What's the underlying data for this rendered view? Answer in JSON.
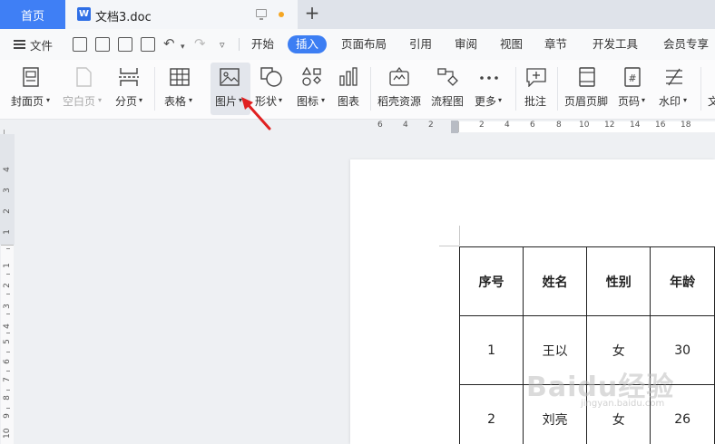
{
  "tabs": {
    "home": "首页",
    "doc_title": "文档3.doc",
    "doc_icon_letter": "W",
    "new_tab": "+"
  },
  "menubar": {
    "file": "文件",
    "items": [
      "开始",
      "插入",
      "页面布局",
      "引用",
      "审阅",
      "视图",
      "章节",
      "开发工具",
      "会员专享"
    ],
    "active": "插入"
  },
  "ribbon": {
    "items": [
      {
        "label": "封面页",
        "dropdown": true,
        "icon": "cover-page-icon"
      },
      {
        "label": "空白页",
        "dropdown": true,
        "icon": "blank-page-icon",
        "disabled": true
      },
      {
        "label": "分页",
        "dropdown": true,
        "icon": "page-break-icon"
      },
      {
        "label": "表格",
        "dropdown": true,
        "icon": "table-icon"
      },
      {
        "label": "图片",
        "dropdown": true,
        "icon": "picture-icon",
        "hovered": true
      },
      {
        "label": "形状",
        "dropdown": true,
        "icon": "shape-icon"
      },
      {
        "label": "图标",
        "dropdown": true,
        "icon": "icons-icon"
      },
      {
        "label": "图表",
        "dropdown": false,
        "icon": "chart-icon"
      },
      {
        "label": "稻壳资源",
        "dropdown": false,
        "icon": "docer-resource-icon"
      },
      {
        "label": "流程图",
        "dropdown": false,
        "icon": "flowchart-icon"
      },
      {
        "label": "更多",
        "dropdown": true,
        "icon": "more-icon"
      },
      {
        "label": "批注",
        "dropdown": false,
        "icon": "comment-icon"
      },
      {
        "label": "页眉页脚",
        "dropdown": false,
        "icon": "header-footer-icon"
      },
      {
        "label": "页码",
        "dropdown": true,
        "icon": "page-number-icon"
      },
      {
        "label": "水印",
        "dropdown": true,
        "icon": "watermark-icon"
      },
      {
        "label": "文",
        "dropdown": false,
        "icon": "text-icon"
      }
    ]
  },
  "ruler": {
    "horizontal_left": [
      "6",
      "4",
      "2"
    ],
    "horizontal_right": [
      "2",
      "4",
      "6",
      "8",
      "10",
      "12",
      "14",
      "16",
      "18"
    ],
    "vertical_top": [
      "4",
      "3",
      "2",
      "1"
    ],
    "vertical_bottom": [
      "1",
      "2",
      "3",
      "4",
      "5",
      "6",
      "7",
      "8",
      "9",
      "10"
    ]
  },
  "table": {
    "rows": [
      [
        "序号",
        "姓名",
        "性别",
        "年龄"
      ],
      [
        "1",
        "王以",
        "女",
        "30"
      ],
      [
        "2",
        "刘亮",
        "女",
        "26"
      ]
    ]
  },
  "watermark": {
    "text": "Baidu经验",
    "url": "jingyan.baidu.com"
  },
  "colors": {
    "accent": "#3c7ef3",
    "home_tab": "#3f7ff5",
    "arrow": "#e02020",
    "unsaved_dot": "#f5a623"
  }
}
